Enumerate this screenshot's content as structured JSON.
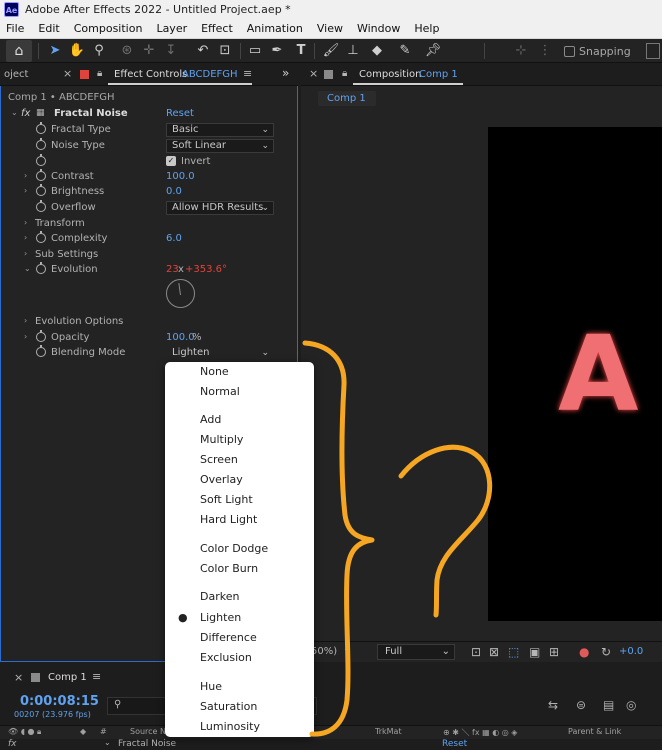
{
  "titlebar": {
    "logo": "Ae",
    "title": "Adobe After Effects 2022 - Untitled Project.aep *"
  },
  "menu": [
    "File",
    "Edit",
    "Composition",
    "Layer",
    "Effect",
    "Animation",
    "View",
    "Window",
    "Help"
  ],
  "toolbar": {
    "home_icon": "home-icon",
    "tools": [
      "selection-tool-icon",
      "hand-tool-icon",
      "zoom-tool-icon",
      "orbit-camera-icon",
      "pan-camera-icon",
      "dolly-camera-icon",
      "rotate-tool-icon",
      "pan-behind-icon",
      "rectangle-tool-icon",
      "pen-tool-icon",
      "type-tool-icon",
      "brush-tool-icon",
      "clone-stamp-icon",
      "eraser-icon",
      "roto-brush-icon",
      "puppet-pin-icon"
    ],
    "snapping_label": "Snapping"
  },
  "left_panel": {
    "project_tab": "oject",
    "effect_controls_tab": "Effect Controls",
    "effect_controls_layer": "ABCDEFGH",
    "header": "Comp 1 • ABCDEFGH",
    "effect_name": "Fractal Noise",
    "reset": "Reset",
    "rows": {
      "fractal_type": {
        "label": "Fractal Type",
        "value": "Basic"
      },
      "noise_type": {
        "label": "Noise Type",
        "value": "Soft Linear"
      },
      "invert": {
        "label": "Invert"
      },
      "contrast": {
        "label": "Contrast",
        "value": "100.0"
      },
      "brightness": {
        "label": "Brightness",
        "value": "0.0"
      },
      "overflow": {
        "label": "Overflow",
        "value": "Allow HDR Results"
      },
      "transform": {
        "label": "Transform"
      },
      "complexity": {
        "label": "Complexity",
        "value": "6.0"
      },
      "sub_settings": {
        "label": "Sub Settings"
      },
      "evolution": {
        "label": "Evolution",
        "revolutions": "23",
        "x": "x",
        "degrees": "+353.6°"
      },
      "evolution_options": {
        "label": "Evolution Options"
      },
      "opacity": {
        "label": "Opacity",
        "value": "100.0",
        "unit": "%"
      },
      "blending_mode": {
        "label": "Blending Mode",
        "value": "Lighten"
      }
    }
  },
  "right_panel": {
    "tab_label": "Composition",
    "tab_comp": "Comp 1",
    "comp_chip": "Comp 1",
    "preview_letter": "A",
    "zoom": "50%)",
    "resolution": "Full",
    "exposure": "+0.0"
  },
  "timeline": {
    "tab": "Comp 1",
    "timecode": "0:00:08:15",
    "frames": "00207 (23.976 fps)",
    "search_icon": "search-icon",
    "columns": {
      "source": "Source N",
      "trkmat": "TrkMat",
      "parent": "Parent & Link"
    },
    "layer": {
      "fx": "fx",
      "name": "Fractal Noise",
      "reset": "Reset"
    }
  },
  "blend_menu": {
    "items": [
      "None",
      "Normal",
      "Add",
      "Multiply",
      "Screen",
      "Overlay",
      "Soft Light",
      "Hard Light",
      "Color Dodge",
      "Color Burn",
      "Darken",
      "Lighten",
      "Difference",
      "Exclusion",
      "Hue",
      "Saturation",
      "Luminosity"
    ],
    "selected": "Lighten"
  },
  "annotation": {
    "color": "#f5a623",
    "shapes": [
      "curly-brace",
      "question-mark"
    ]
  },
  "colors": {
    "accent_blue": "#5fa2f0",
    "focus_border": "#2e6bd0",
    "keyframe_red": "#e0433a",
    "letter": "#f06f72"
  }
}
